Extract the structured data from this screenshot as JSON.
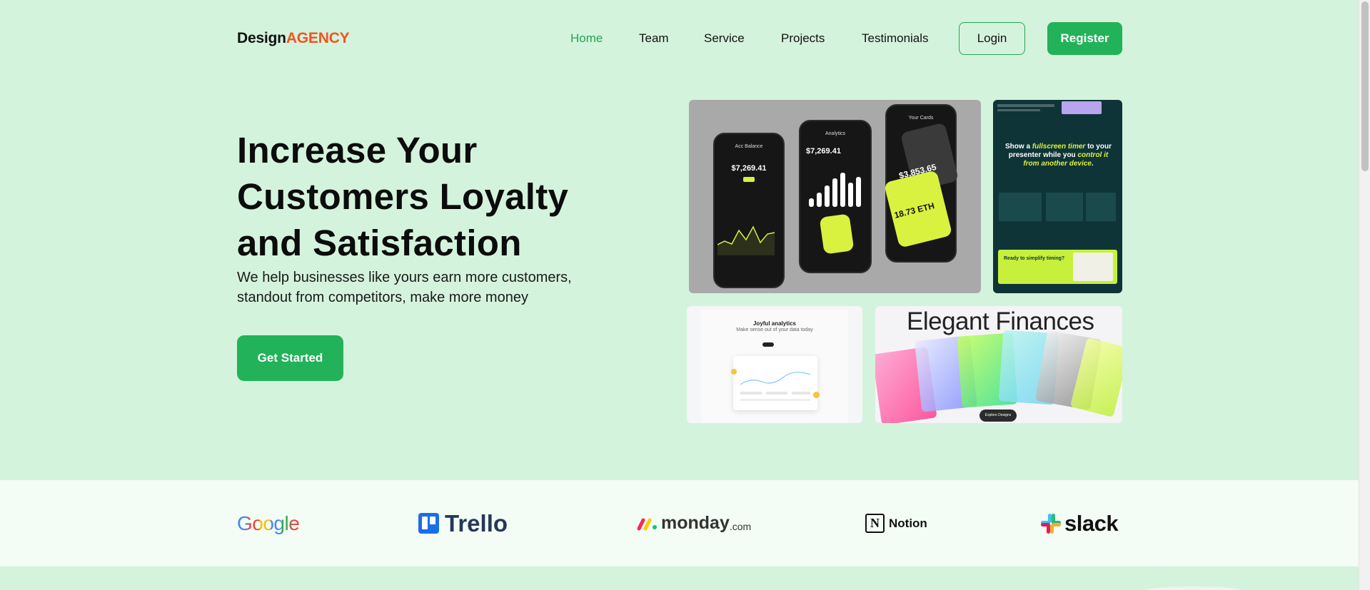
{
  "header": {
    "logo_primary": "Design",
    "logo_accent": "AGENCY",
    "nav": [
      {
        "label": "Home",
        "active": true
      },
      {
        "label": "Team",
        "active": false
      },
      {
        "label": "Service",
        "active": false
      },
      {
        "label": "Projects",
        "active": false
      },
      {
        "label": "Testimonials",
        "active": false
      }
    ],
    "login_label": "Login",
    "register_label": "Register"
  },
  "hero": {
    "title": "Increase Your Customers Loyalty and Satisfaction",
    "subtitle": "We help businesses like yours earn more customers, standout from competitors, make more money",
    "cta_label": "Get Started"
  },
  "gallery": {
    "phones": {
      "screen1_title": "Acc Balance",
      "screen1_balance": "$7,269.41",
      "screen2_title": "Analytics",
      "screen2_balance": "$7,269.41",
      "screen3_title": "Your Cards",
      "screen3_balance": "$3,853.65",
      "eth_value": "18.73 ETH"
    },
    "timer": {
      "headline_part1": "Show a ",
      "headline_highlight1": "fullscreen timer",
      "headline_part2": " to your presenter while you ",
      "headline_highlight2": "control it from another device",
      "headline_end": ".",
      "cta_text": "Ready to simplify timing?"
    },
    "analytics": {
      "title": "Joyful analytics",
      "subtitle": "Make sense out of your data today"
    },
    "finances": {
      "title": "Elegant Finances",
      "button": "Explore Designs"
    }
  },
  "partners": [
    {
      "name": "Google"
    },
    {
      "name": "Trello"
    },
    {
      "name": "monday",
      "suffix": ".com"
    },
    {
      "name": "Notion"
    },
    {
      "name": "slack"
    }
  ],
  "colors": {
    "background": "#d4f3dc",
    "accent_green": "#22b259",
    "logo_accent": "#f0541e",
    "strip_background": "#f3fcf5"
  }
}
